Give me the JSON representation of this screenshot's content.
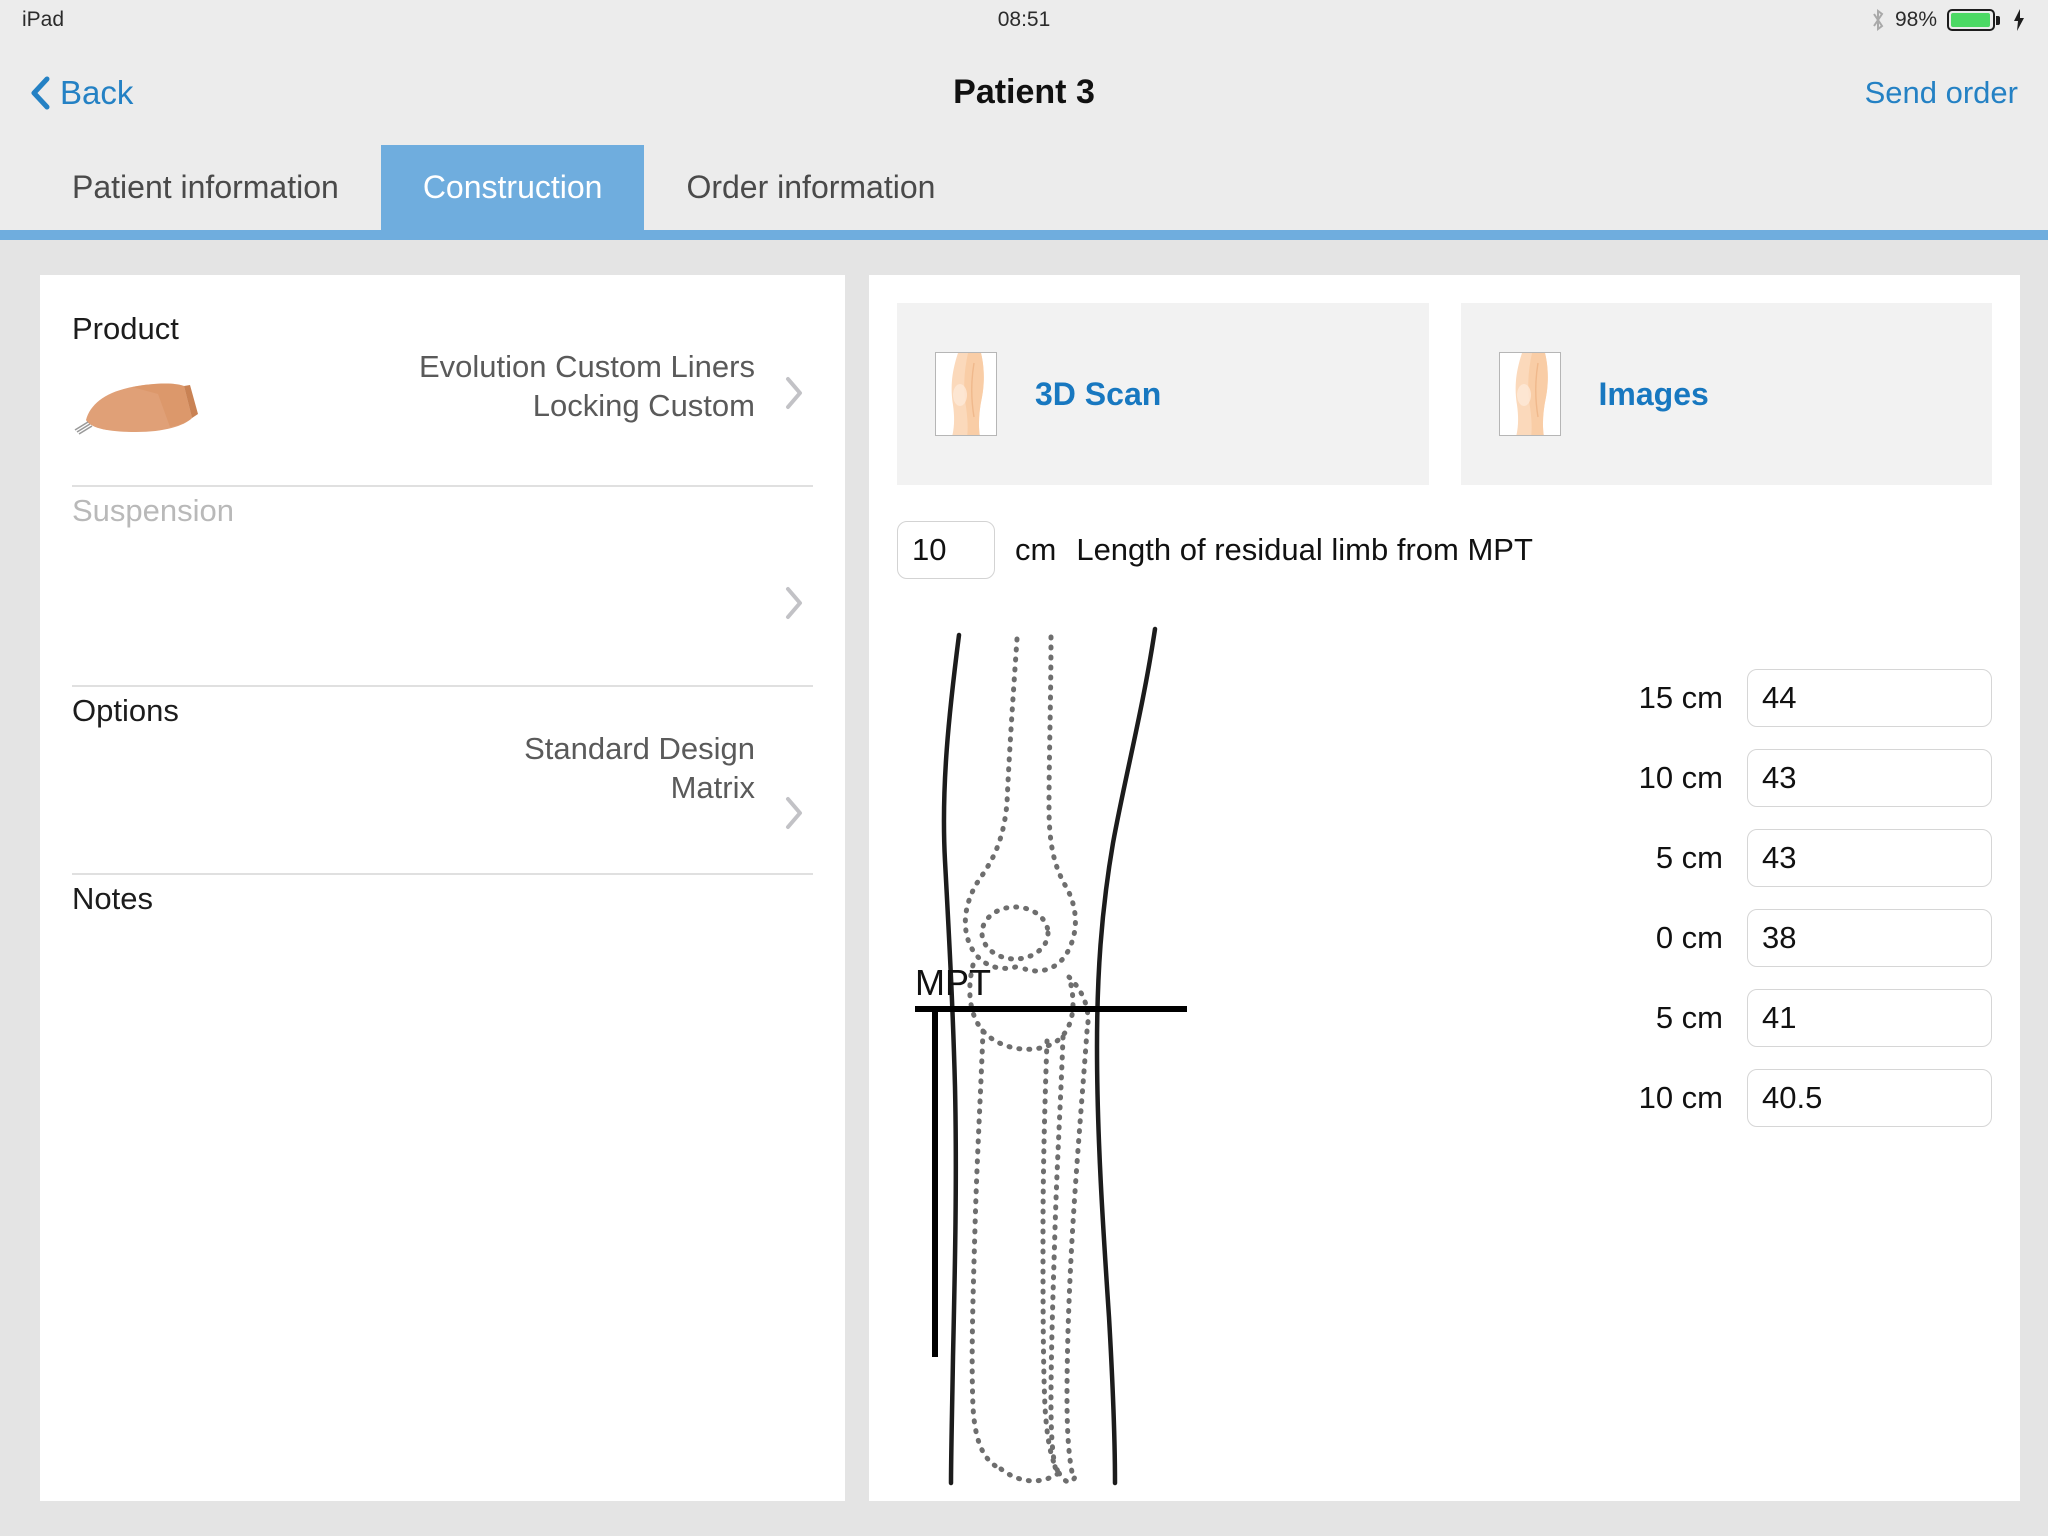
{
  "statusbar": {
    "device": "iPad",
    "time": "08:51",
    "battery_percent": "98%",
    "bluetooth_icon": "bluetooth-icon",
    "charging_icon": "lightning-bolt-icon",
    "battery_level": 98,
    "battery_color": "#4cd964"
  },
  "navbar": {
    "back_label": "Back",
    "title": "Patient 3",
    "send_order_label": "Send order",
    "accent_color": "#2481c4"
  },
  "tabs": [
    {
      "label": "Patient information",
      "active": false
    },
    {
      "label": "Construction",
      "active": true
    },
    {
      "label": "Order information",
      "active": false
    }
  ],
  "tab_accent_color": "#6fadde",
  "left_panel": {
    "rows": [
      {
        "label": "Product",
        "value": "Evolution Custom Liners\nLocking Custom",
        "muted": false,
        "has_thumb": true
      },
      {
        "label": "Suspension",
        "value": "",
        "muted": true,
        "has_thumb": false
      },
      {
        "label": "Options",
        "value": "Standard Design\nMatrix",
        "muted": false,
        "has_thumb": false
      },
      {
        "label": "Notes",
        "value": "",
        "muted": false,
        "has_thumb": false
      }
    ]
  },
  "right_panel": {
    "cards": [
      {
        "label": "3D Scan",
        "icon": "leg-thumbnail-icon"
      },
      {
        "label": "Images",
        "icon": "leg-thumbnail-icon"
      }
    ],
    "length": {
      "value": "10",
      "unit": "cm",
      "label": "Length of residual limb from MPT"
    },
    "diagram": {
      "mpt_label": "MPT"
    },
    "measurements": [
      {
        "label": "15 cm",
        "value": "44"
      },
      {
        "label": "10 cm",
        "value": "43"
      },
      {
        "label": "5 cm",
        "value": "43"
      },
      {
        "label": "0 cm",
        "value": "38"
      },
      {
        "label": "5 cm",
        "value": "41"
      },
      {
        "label": "10 cm",
        "value": "40.5"
      }
    ]
  }
}
